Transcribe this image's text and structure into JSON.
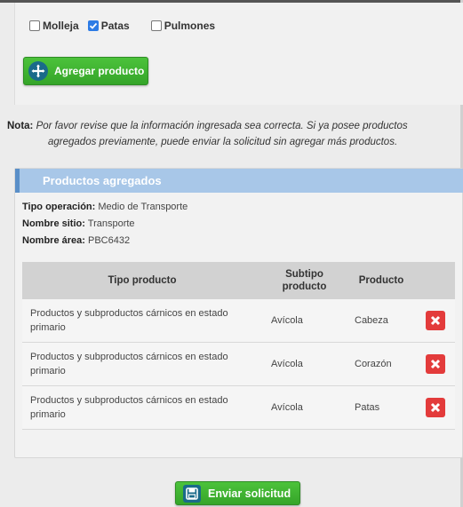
{
  "checkboxes": [
    {
      "label": "Molleja",
      "checked": false
    },
    {
      "label": "Patas",
      "checked": true
    },
    {
      "label": "Pulmones",
      "checked": false
    }
  ],
  "add_button": {
    "label": "Agregar producto",
    "icon": "plus-arrows-icon"
  },
  "note": {
    "prefix": "Nota:",
    "line1": "Por favor revise que la información ingresada sea correcta. Si ya posee productos",
    "line2": "agregados previamente, puede enviar la solicitud sin agregar más productos."
  },
  "card": {
    "title": "Productos agregados",
    "info": [
      {
        "label": "Tipo operación:",
        "value": "Medio de Transporte"
      },
      {
        "label": "Nombre sitio:",
        "value": "Transporte"
      },
      {
        "label": "Nombre área:",
        "value": "PBC6432"
      }
    ],
    "table": {
      "headers": {
        "tipo": "Tipo producto",
        "subtipo_l1": "Subtipo",
        "subtipo_l2": "producto",
        "producto": "Producto"
      },
      "rows": [
        {
          "tipo_l1": "Productos y subproductos cárnicos en estado",
          "tipo_l2": "primario",
          "subtipo": "Avícola",
          "producto": "Cabeza"
        },
        {
          "tipo_l1": "Productos y subproductos cárnicos en estado",
          "tipo_l2": "primario",
          "subtipo": "Avícola",
          "producto": "Corazón"
        },
        {
          "tipo_l1": "Productos y subproductos cárnicos en estado",
          "tipo_l2": "primario",
          "subtipo": "Avícola",
          "producto": "Patas"
        }
      ]
    }
  },
  "send_button": {
    "label": "Enviar solicitud",
    "icon": "save-icon"
  },
  "colors": {
    "green": "#3db530",
    "header_blue": "#a8c7e8",
    "delete_red": "#e33b3b",
    "checkbox_blue": "#2c7be5"
  }
}
